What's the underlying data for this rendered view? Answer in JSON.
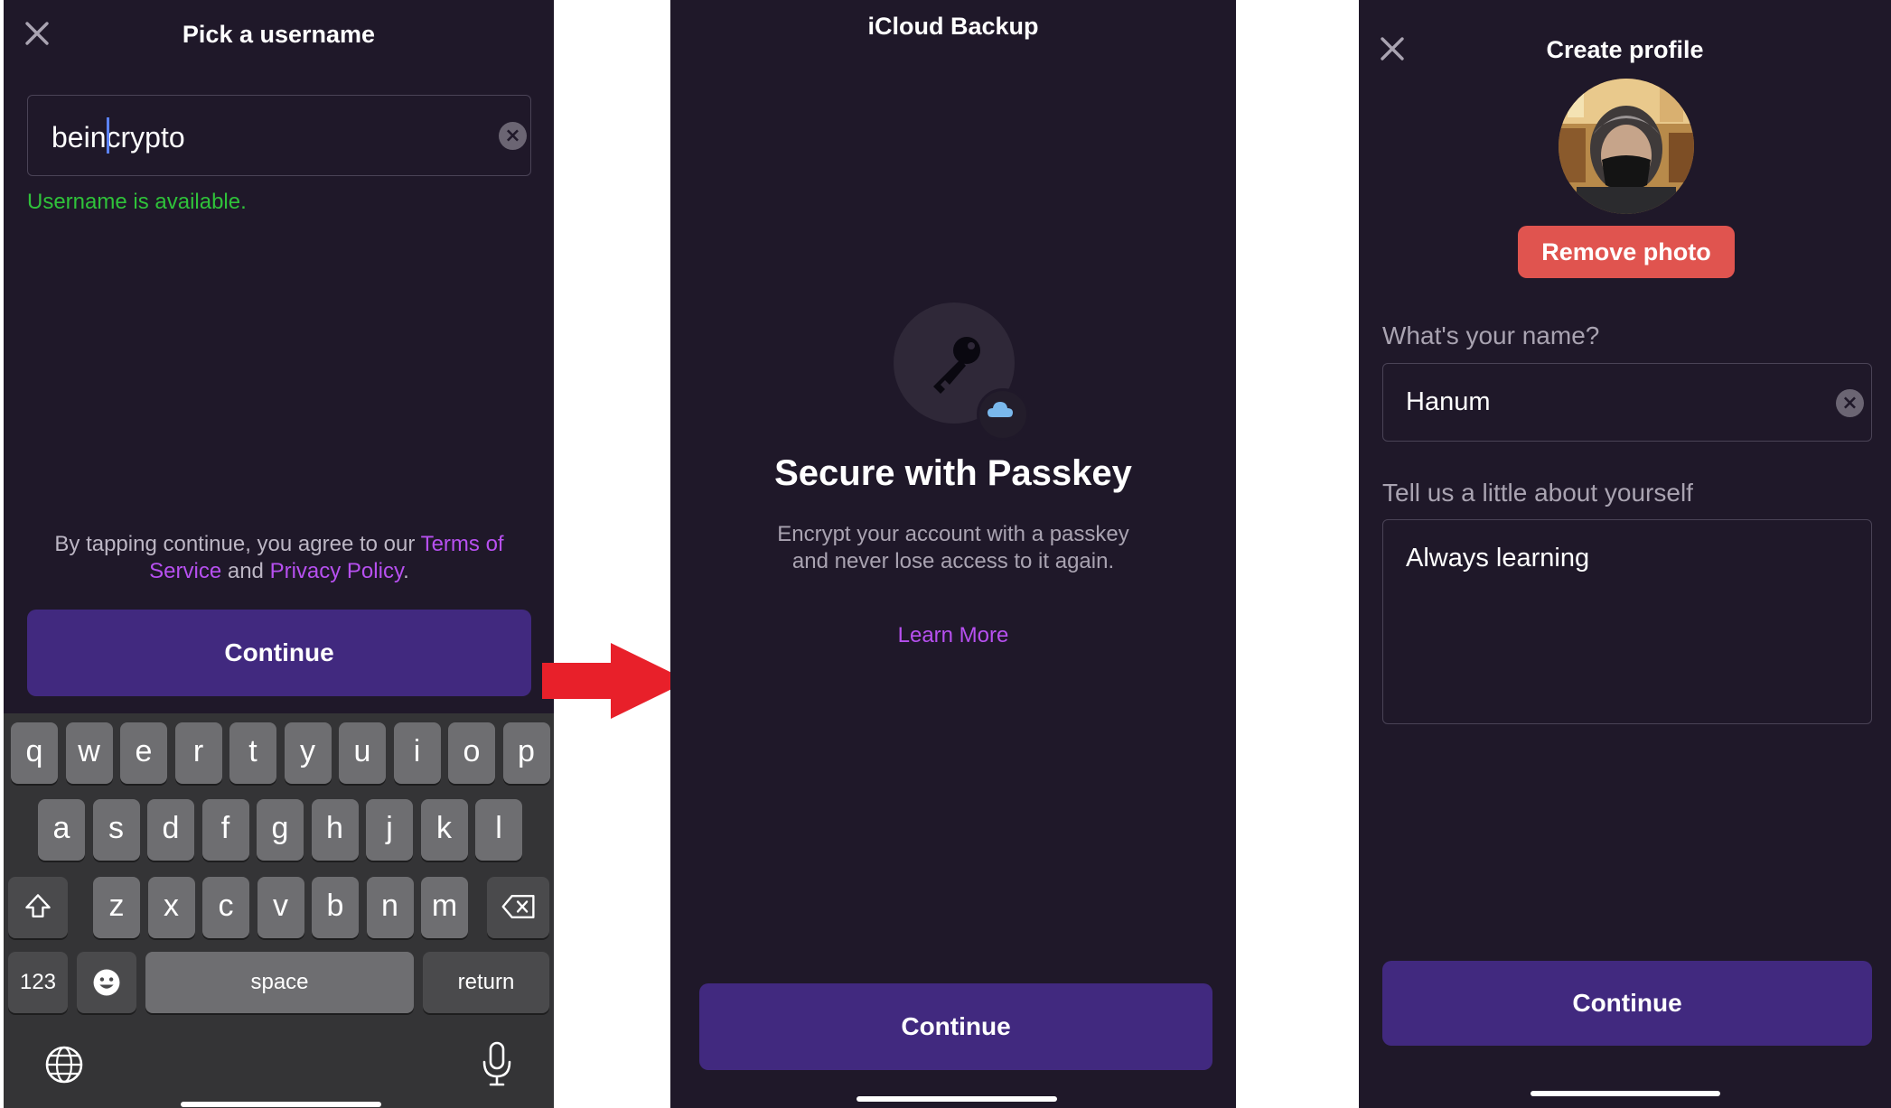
{
  "screen1": {
    "title": "Pick a username",
    "username_value": "beincrypto",
    "status_text": "Username is available.",
    "terms": {
      "prefix": "By tapping continue, you agree to our ",
      "terms_link": "Terms of Service",
      "middle": " and ",
      "privacy_link": "Privacy Policy",
      "suffix": "."
    },
    "continue_label": "Continue",
    "keyboard": {
      "row1": [
        "q",
        "w",
        "e",
        "r",
        "t",
        "y",
        "u",
        "i",
        "o",
        "p"
      ],
      "row2": [
        "a",
        "s",
        "d",
        "f",
        "g",
        "h",
        "j",
        "k",
        "l"
      ],
      "row3": [
        "z",
        "x",
        "c",
        "v",
        "b",
        "n",
        "m"
      ],
      "numbers_key": "123",
      "space_key": "space",
      "return_key": "return"
    }
  },
  "screen2": {
    "title": "iCloud Backup",
    "heading": "Secure with Passkey",
    "description": "Encrypt your account with a passkey and never lose access to it again.",
    "learn_more": "Learn More",
    "continue_label": "Continue"
  },
  "screen3": {
    "title": "Create profile",
    "remove_photo_label": "Remove photo",
    "name_label": "What's your name?",
    "name_value": "Hanum",
    "about_label": "Tell us a little about yourself",
    "about_value": "Always learning",
    "continue_label": "Continue"
  },
  "colors": {
    "background": "#1f1829",
    "primary_button": "#41297f",
    "link": "#b750f0",
    "success": "#2fc23a",
    "destructive": "#e0544f",
    "arrow": "#e8202a"
  }
}
